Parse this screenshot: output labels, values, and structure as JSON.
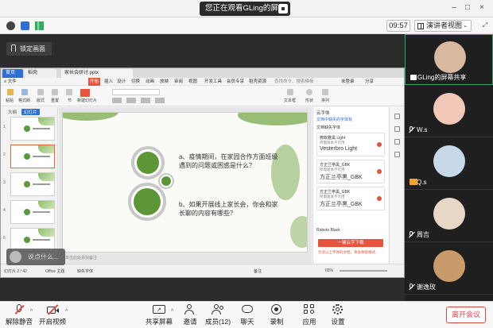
{
  "title_bar": {
    "share_status": "您正在观看GLing的屏幕"
  },
  "info_row": {
    "clock": "09:57",
    "view_label": "演讲者视图"
  },
  "stage": {
    "lock_label": "锁定画面",
    "speaking_name": "说点什么..."
  },
  "wps": {
    "tabs": [
      "首页",
      "稻壳",
      "家长会研讨.pptx"
    ],
    "menu": [
      "开始",
      "插入",
      "设计",
      "切换",
      "动画",
      "放映",
      "审阅",
      "视图",
      "开发工具",
      "会员专享",
      "稻壳资源",
      "查找命令、搜索模板"
    ],
    "menu_right": [
      "未登录",
      "分享"
    ],
    "tool_labels": [
      "粘贴",
      "格式刷",
      "版式",
      "重置",
      "节",
      "新建幻灯片",
      "文本框",
      "形状",
      "排列"
    ],
    "thumb_tabs": [
      "大纲",
      "幻灯片"
    ],
    "slide": {
      "q1": "a、疫情期间，在家园合作方面班级遇到的问题或困惑是什么？",
      "q2": "b、如果开展线上家长会，你会和家长聊的内容有哪些？",
      "notes": "单击此处添加备注"
    },
    "font_panel": {
      "title": "云字体",
      "subtitle": "文档中缺失的字体有",
      "missing_label": "文档缺失字体",
      "cards": [
        {
          "a": "微软雅黑 Light",
          "b": "所需版本不可用",
          "c": "Vesterbro Light"
        },
        {
          "a": "方正兰亭黑_GBK",
          "b": "所需版本不可用",
          "c": "方正兰亭黑_GBK"
        },
        {
          "a": "方正兰亭黑_GBK",
          "b": "所需版本不可用",
          "c": "方正兰亭黑_GBK"
        }
      ],
      "roboto": "Roboto Black",
      "download_button": "一键云字下载",
      "note": "包含以上字体的文档，将会保留格式"
    },
    "status": {
      "page": "幻灯片 2 / 42",
      "theme": "Office 主题",
      "spell": "缺失字体",
      "notes_btn": "备注",
      "zoom": "65%"
    }
  },
  "participants": [
    {
      "name": "GLing的屏幕共享",
      "avatar_color": "#d9b8a0",
      "muted": false,
      "active": true
    },
    {
      "name": "W.s",
      "avatar_color": "#f2c9b8",
      "muted": true,
      "active": false
    },
    {
      "name": "Q.s",
      "avatar_color": "#c7d8e8",
      "muted": true,
      "active": false,
      "camera_off": true
    },
    {
      "name": "周吉",
      "avatar_color": "#e8d8c8",
      "muted": true,
      "active": false
    },
    {
      "name": "谢逸玫",
      "avatar_color": "#c99a6a",
      "muted": true,
      "active": false
    }
  ],
  "toolbar": {
    "mute": "解除静音",
    "video": "开启视频",
    "share": "共享屏幕",
    "invite": "邀请",
    "members": "成员(12)",
    "chat": "聊天",
    "record": "录制",
    "apps": "应用",
    "settings": "设置",
    "leave": "离开会议"
  },
  "colors": {
    "accent_green": "#5d9637",
    "leave_red": "#e04848",
    "wps_red": "#e9533b"
  }
}
